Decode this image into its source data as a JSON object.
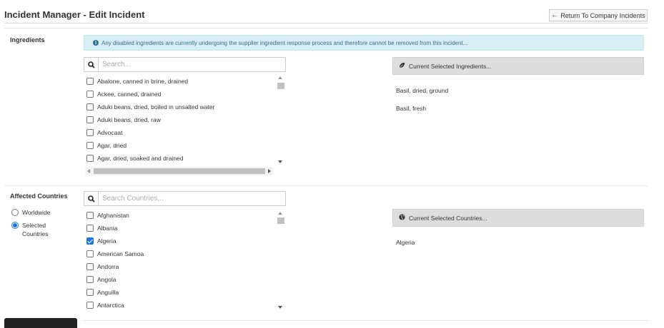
{
  "header": {
    "title": "Incident Manager - Edit Incident",
    "return_label": "Return To Company Incidents"
  },
  "ingredients": {
    "label": "Ingredients",
    "alert": "Any disabled ingredients are currently undergoing the supplier ingredient response process and therefore cannot be removed from this incident...",
    "search_placeholder": "Search...",
    "items": [
      {
        "label": "Abalone, canned in brine, drained",
        "checked": false
      },
      {
        "label": "Ackee, canned, drained",
        "checked": false
      },
      {
        "label": "Aduki beans, dried, boiled in unsalted water",
        "checked": false
      },
      {
        "label": "Aduki beans, dried, raw",
        "checked": false
      },
      {
        "label": "Advocaat",
        "checked": false
      },
      {
        "label": "Agar, dried",
        "checked": false
      },
      {
        "label": "Agar, dried, soaked and drained",
        "checked": false
      }
    ],
    "selected_header": "Current Selected Ingredients...",
    "selected": [
      "Basil, dried, ground",
      "Basil, fresh"
    ]
  },
  "countries": {
    "label": "Affected Countries",
    "options": [
      {
        "label": "Worldwide",
        "checked": false
      },
      {
        "label": "Selected Countries",
        "checked": true
      }
    ],
    "search_placeholder": "Search Countries...",
    "items": [
      {
        "label": "Afghanistan",
        "checked": false
      },
      {
        "label": "Albania",
        "checked": false
      },
      {
        "label": "Algeria",
        "checked": true
      },
      {
        "label": "American Samoa",
        "checked": false
      },
      {
        "label": "Andorra",
        "checked": false
      },
      {
        "label": "Angola",
        "checked": false
      },
      {
        "label": "Anguilla",
        "checked": false
      },
      {
        "label": "Antarctica",
        "checked": false
      }
    ],
    "selected_header": "Current Selected Countries...",
    "selected": [
      "Algeria"
    ]
  },
  "colors": {
    "alert_bg": "#d9edf7",
    "alert_text": "#31708f",
    "accent": "#1a73e8"
  }
}
